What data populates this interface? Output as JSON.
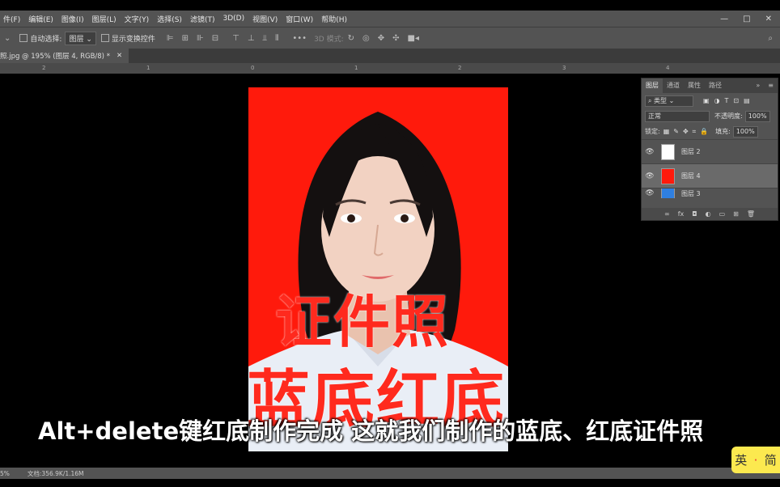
{
  "menu": [
    "件(F)",
    "编辑(E)",
    "图像(I)",
    "图层(L)",
    "文字(Y)",
    "选择(S)",
    "滤镜(T)",
    "3D(D)",
    "视图(V)",
    "窗口(W)",
    "帮助(H)"
  ],
  "window_buttons": [
    "—",
    "□",
    "✕"
  ],
  "options": {
    "auto_select_label": "自动选择:",
    "auto_select_value": "图层",
    "show_transform_label": "显示变换控件",
    "mode_3d_label": "3D 模式:"
  },
  "doc_tab": {
    "title": "照.jpg @ 195% (图层 4, RGB/8) *",
    "close": "✕"
  },
  "ruler_ticks": [
    "2",
    "1",
    "0",
    "1",
    "2",
    "3",
    "4"
  ],
  "photo_overlay": {
    "line1": "证件照",
    "line2": "蓝底红底"
  },
  "subtitle": "Alt+delete键红底制作完成 这就我们制作的蓝底、红底证件照",
  "status": {
    "zoom": "5%",
    "doc_info": "文档:356.9K/1.16M"
  },
  "ime": {
    "left": "英",
    "sep": "·",
    "right": "简"
  },
  "layers_panel": {
    "tabs": [
      "图层",
      "通道",
      "属性",
      "路径"
    ],
    "filter_label": "类型",
    "blend_mode": "正常",
    "opacity_label": "不透明度:",
    "opacity_value": "100%",
    "lock_label": "锁定:",
    "fill_label": "填充:",
    "fill_value": "100%",
    "layers": [
      {
        "name": "图层 2",
        "thumb_color": "#ffffff",
        "selected": false
      },
      {
        "name": "图层 4",
        "thumb_color": "#ff1a0c",
        "selected": true
      },
      {
        "name": "图层 3",
        "thumb_color": "#2f7fe0",
        "selected": false
      }
    ],
    "footer_icons": [
      "link-icon",
      "fx-icon",
      "mask-icon",
      "adjustment-icon",
      "folder-icon",
      "new-layer-icon",
      "trash-icon"
    ],
    "footer_labels": [
      "∞",
      "fx",
      "◘",
      "◐",
      "▭",
      "⊞",
      "🗑"
    ]
  },
  "colors": {
    "accent_red": "#ff1a0c",
    "panel_bg": "#535353",
    "subtitle": "#ffffff",
    "ime_bg": "#fce94f"
  }
}
